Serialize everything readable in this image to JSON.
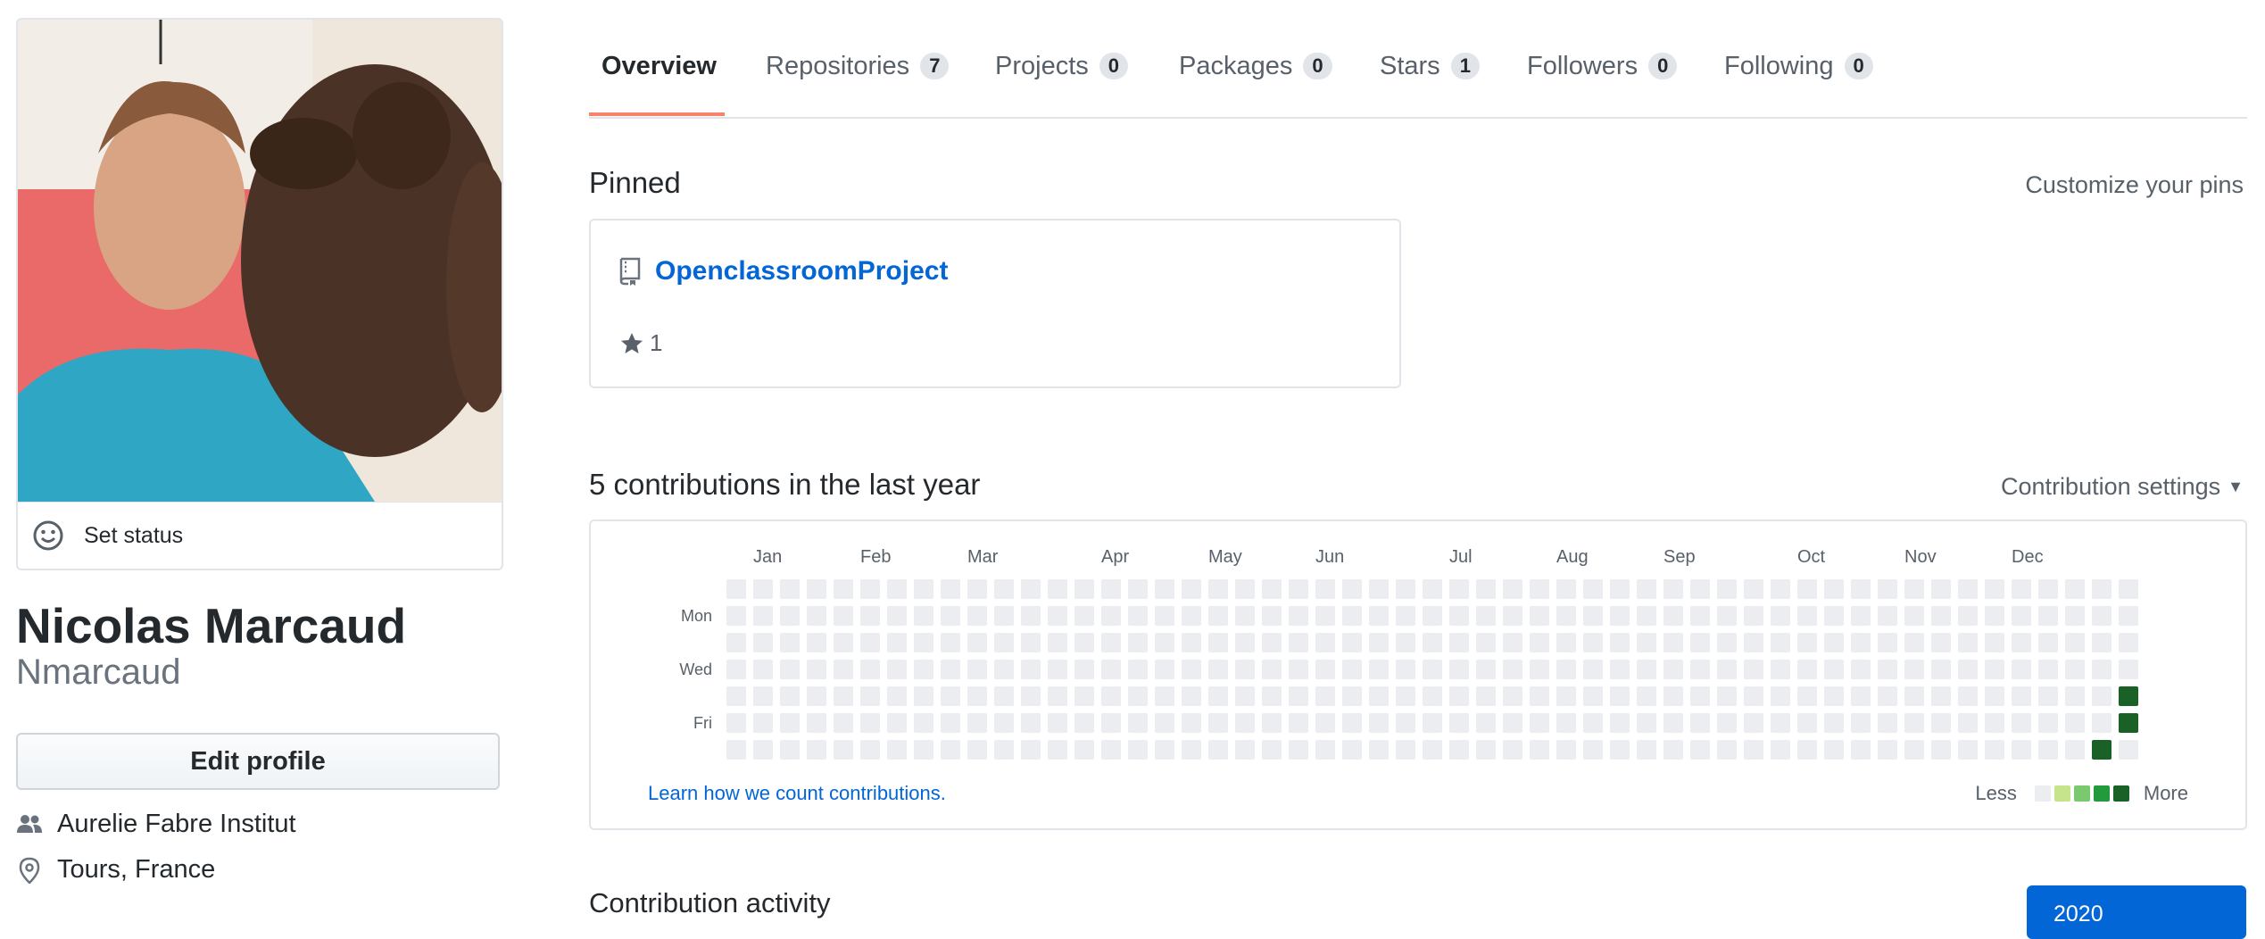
{
  "sidebar": {
    "status_label": "Set status",
    "full_name": "Nicolas Marcaud",
    "username": "Nmarcaud",
    "edit_profile_label": "Edit profile",
    "organization": "Aurelie Fabre Institut",
    "location": "Tours, France"
  },
  "tabs": [
    {
      "label": "Overview",
      "count": null,
      "selected": true
    },
    {
      "label": "Repositories",
      "count": "7"
    },
    {
      "label": "Projects",
      "count": "0"
    },
    {
      "label": "Packages",
      "count": "0"
    },
    {
      "label": "Stars",
      "count": "1"
    },
    {
      "label": "Followers",
      "count": "0"
    },
    {
      "label": "Following",
      "count": "0"
    }
  ],
  "pinned": {
    "title": "Pinned",
    "customize_label": "Customize your pins",
    "repo": {
      "name": "OpenclassroomProject",
      "stars": "1",
      "icon": "repo-icon"
    }
  },
  "contributions": {
    "title": "5 contributions in the last year",
    "settings_label": "Contribution settings",
    "months": [
      "Jan",
      "Feb",
      "Mar",
      "Apr",
      "May",
      "Jun",
      "Jul",
      "Aug",
      "Sep",
      "Oct",
      "Nov",
      "Dec"
    ],
    "day_labels": [
      "Mon",
      "Wed",
      "Fri"
    ],
    "learn_link": "Learn how we count contributions.",
    "legend_less": "Less",
    "legend_more": "More",
    "legend_colors": [
      "#ebedf0",
      "#c6e48b",
      "#7bc96f",
      "#239a3b",
      "#196127"
    ],
    "weeks": 53,
    "active_days": [
      {
        "week": 52,
        "day": 4,
        "level": 4
      },
      {
        "week": 52,
        "day": 5,
        "level": 4
      },
      {
        "week": 51,
        "day": 6,
        "level": 4
      }
    ]
  },
  "activity": {
    "title": "Contribution activity",
    "year_button": "2020"
  }
}
